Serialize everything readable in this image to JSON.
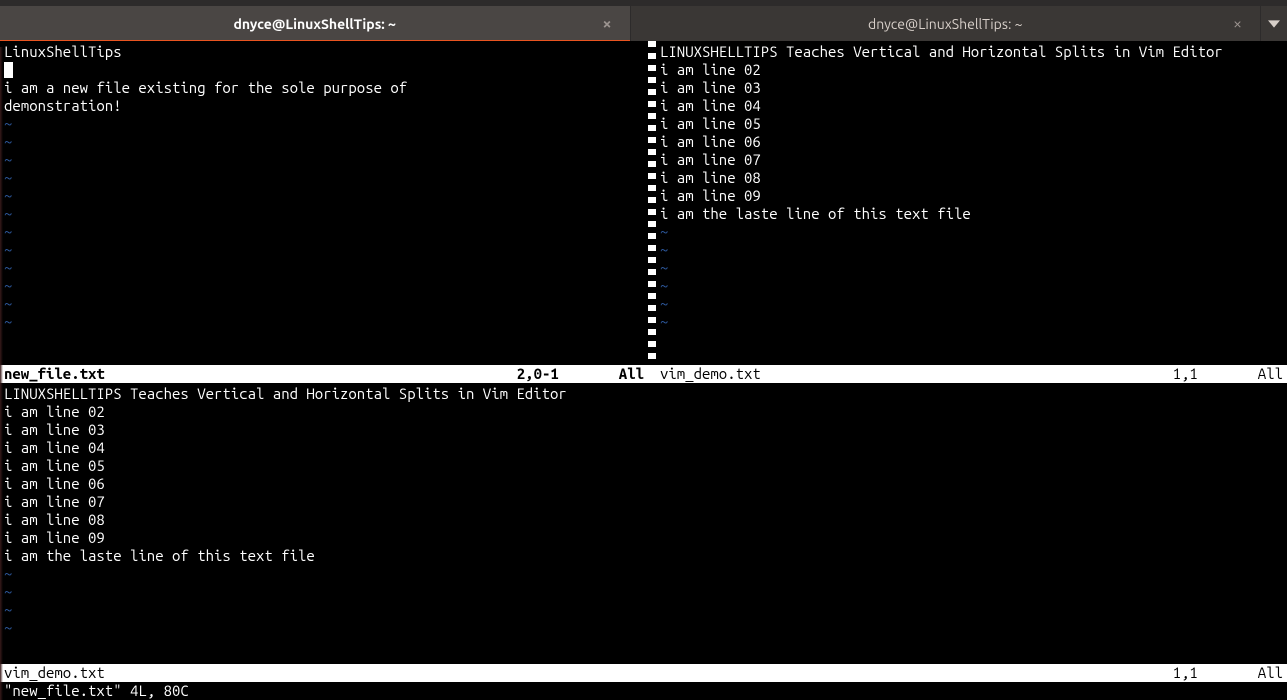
{
  "tabs": [
    {
      "title": "dnyce@LinuxShellTips: ~",
      "active": true
    },
    {
      "title": "dnyce@LinuxShellTips: ~",
      "active": false
    }
  ],
  "panes": {
    "top_left": {
      "lines": [
        "LinuxShellTips",
        " ",
        "i am a new file existing for the sole purpose of",
        "demonstration!"
      ],
      "tildes": 12,
      "status": {
        "file": "new_file.txt",
        "pos": "2,0-1",
        "scroll": "All"
      },
      "active": true,
      "cursor_line_index": 1
    },
    "top_right": {
      "lines": [
        "LINUXSHELLTIPS Teaches Vertical and Horizontal Splits in Vim Editor",
        "i am line 02",
        "i am line 03",
        "i am line 04",
        "i am line 05",
        "i am line 06",
        "i am line 07",
        "i am line 08",
        "i am line 09",
        "i am the laste line of this text file"
      ],
      "tildes": 6,
      "status": {
        "file": "vim_demo.txt",
        "pos": "1,1",
        "scroll": "All"
      },
      "active": false
    },
    "bottom": {
      "lines": [
        "LINUXSHELLTIPS Teaches Vertical and Horizontal Splits in Vim Editor",
        "i am line 02",
        "i am line 03",
        "i am line 04",
        "i am line 05",
        "i am line 06",
        "i am line 07",
        "i am line 08",
        "i am line 09",
        "i am the laste line of this text file"
      ],
      "tildes": 4,
      "status": {
        "file": "vim_demo.txt",
        "pos": "1,1",
        "scroll": "All"
      },
      "active": false
    }
  },
  "command_line": "\"new_file.txt\" 4L, 80C"
}
